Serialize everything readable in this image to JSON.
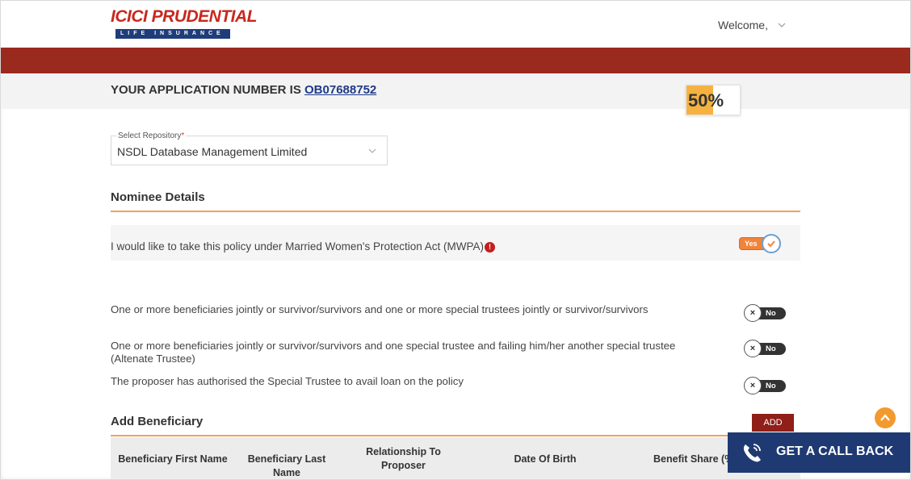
{
  "header": {
    "logo_main": "ICICI PRUDENTIAL",
    "logo_sub": "LIFE INSURANCE",
    "welcome": "Welcome,"
  },
  "application": {
    "prefix": "YOUR APPLICATION NUMBER IS",
    "number": "OB07688752",
    "progress_label": "50%",
    "progress_fraction": 0.5
  },
  "repository": {
    "label": "Select Repository",
    "required_mark": "*",
    "value": "NSDL Database Management Limited"
  },
  "nominee": {
    "title": "Nominee Details",
    "mwpa_text": "I would like to take this policy under Married Women's Protection Act (MWPA)",
    "mwpa_toggle": "Yes",
    "info_icon_glyph": "!"
  },
  "options": [
    {
      "text": "One or more beneficiaries jointly or survivor/survivors and one or more special trustees jointly or survivor/survivors",
      "toggle": "No"
    },
    {
      "text": "One or more beneficiaries jointly or survivor/survivors and one special trustee and failing him/her another special trustee (Altenate Trustee)",
      "toggle": "No"
    },
    {
      "text": "The proposer has authorised the Special Trustee to avail loan on the policy",
      "toggle": "No"
    }
  ],
  "beneficiary": {
    "title": "Add Beneficiary",
    "add_label": "ADD",
    "columns": [
      "Beneficiary First Name",
      "Beneficiary Last Name",
      "Relationship To Proposer",
      "Date Of Birth",
      "Benefit Share (%"
    ]
  },
  "callback": {
    "label": "GET A CALL BACK"
  },
  "colors": {
    "brand_red": "#9b2a1e",
    "accent_orange": "#f1833a",
    "navy": "#1f3a73",
    "progress_fill": "#f5b240"
  },
  "icons": [
    "chevron-down-icon",
    "info-icon",
    "check-icon",
    "close-icon",
    "chevron-up-icon",
    "phone-icon"
  ]
}
